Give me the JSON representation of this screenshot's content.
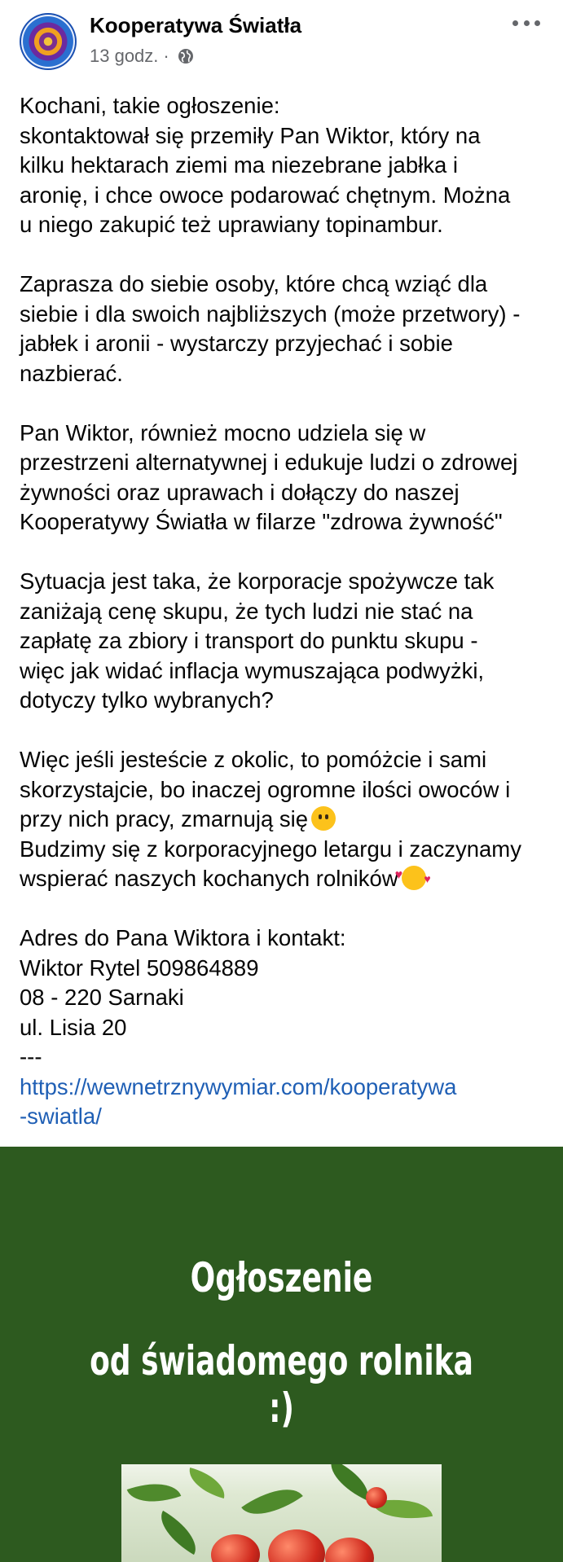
{
  "post": {
    "page_name": "Kooperatywa Światła",
    "time": "13 godz.",
    "separator": "·",
    "audience_icon": "globe-icon",
    "more_icon": "more-options-icon",
    "paragraphs": [
      [
        "Kochani, takie ogłoszenie:",
        "skontaktował się przemiły Pan Wiktor, który na",
        "kilku hektarach ziemi ma niezebrane jabłka i",
        "aronię, i chce  owoce podarować chętnym.  Można",
        "u niego zakupić też uprawiany topinambur."
      ],
      [
        "Zaprasza do siebie osoby, które chcą wziąć dla",
        "siebie i dla swoich najbliższych (może przetwory) -",
        "jabłek i aronii - wystarczy przyjechać i sobie",
        "nazbierać."
      ],
      [
        "Pan Wiktor, również mocno udziela się w",
        "przestrzeni alternatywnej i edukuje ludzi o zdrowej",
        "żywności oraz uprawach i dołączy do naszej",
        "Kooperatywy Światła w filarze \"zdrowa żywność\""
      ],
      [
        "Sytuacja jest taka, że korporacje spożywcze tak",
        "zaniżają cenę skupu, że tych ludzi nie stać na",
        "zapłatę za zbiory i transport do punktu skupu -",
        "więc jak widać inflacja wymuszająca podwyżki,",
        "dotyczy tylko wybranych?"
      ],
      [
        "Więc jeśli jesteście z okolic, to pomóżcie i sami",
        "skorzystajcie, bo inaczej ogromne ilości owoców i",
        "przy nich pracy, zmarnują się",
        "Budzimy się z korporacyjnego letargu i  zaczynamy",
        "wspierać naszych kochanych rolników"
      ],
      [
        "Adres do Pana Wiktora i kontakt:",
        "Wiktor Rytel 509864889",
        "08 - 220 Sarnaki",
        "ul. Lisia 20",
        "---"
      ]
    ],
    "link_lines": [
      "https://wewnetrznywymiar.com/kooperatywa",
      "-swiatla/"
    ],
    "emojis": [
      "neutral-face-emoji",
      "smiling-face-with-hearts-emoji"
    ]
  },
  "image": {
    "title_line_1": "Ogłoszenie",
    "title_line_2": "od świadomego rolnika :)",
    "background_color": "#2d5a1f"
  },
  "colors": {
    "link": "#1f5fb5",
    "meta": "#65676b",
    "text": "#050505"
  }
}
